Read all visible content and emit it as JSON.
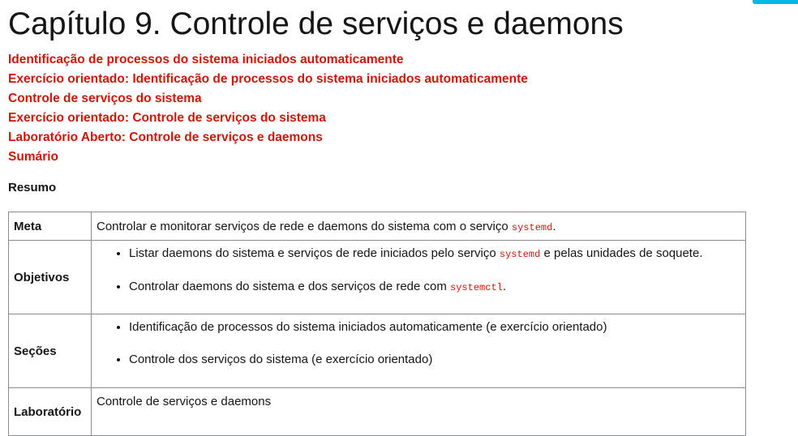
{
  "page": {
    "title": "Capítulo 9. Controle de serviços e daemons",
    "toc": [
      "Identificação de processos do sistema iniciados automaticamente",
      "Exercício orientado: Identificação de processos do sistema iniciados automaticamente",
      "Controle de serviços do sistema",
      "Exercício orientado: Controle de serviços do sistema",
      "Laboratório Aberto: Controle de serviços e daemons",
      "Sumário"
    ],
    "summary_label": "Resumo"
  },
  "table": {
    "meta": {
      "label": "Meta",
      "text_before": "Controlar e monitorar serviços de rede e daemons do sistema com o serviço ",
      "code": "systemd",
      "text_after": "."
    },
    "objectives": {
      "label": "Objetivos",
      "item1_before": "Listar daemons do sistema e serviços de rede iniciados pelo serviço ",
      "item1_code": "systemd",
      "item1_after": " e pelas unidades de soquete.",
      "item2_before": "Controlar daemons do sistema e dos serviços de rede com ",
      "item2_code": "systemctl",
      "item2_after": "."
    },
    "sections": {
      "label": "Seções",
      "items": [
        "Identificação de processos do sistema iniciados automaticamente (e exercício orientado)",
        "Controle dos serviços do sistema (e exercício orientado)"
      ]
    },
    "lab": {
      "label": "Laboratório",
      "text": "Controle de serviços e daemons"
    }
  },
  "colors": {
    "link": "#c9190b",
    "accent_tab": "#00b9e4",
    "text": "#151515",
    "border": "#8a8d90"
  }
}
